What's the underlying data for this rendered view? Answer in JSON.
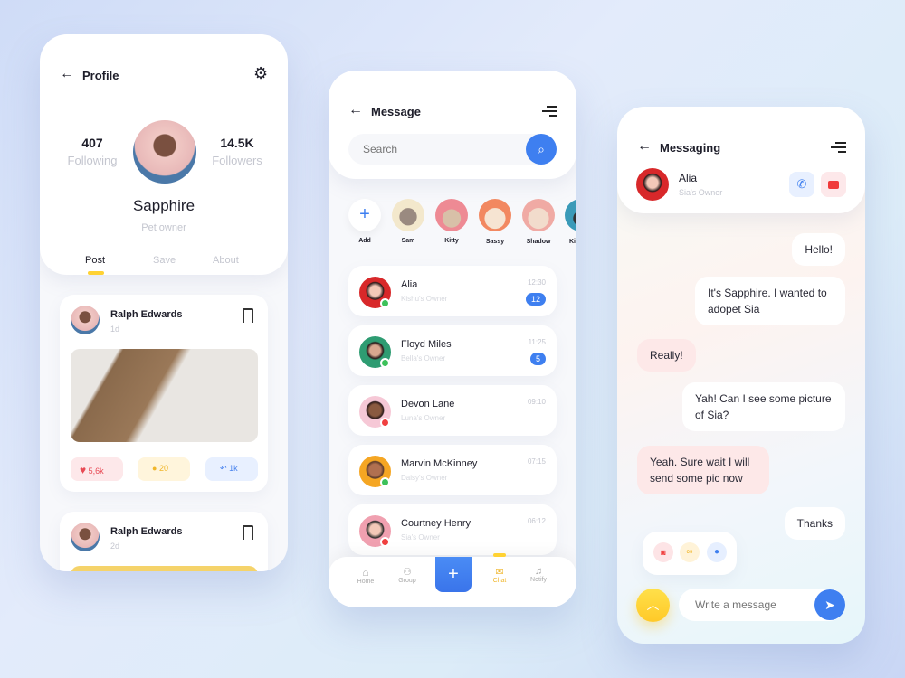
{
  "profile": {
    "title": "Profile",
    "following_count": "407",
    "following_label": "Following",
    "followers_count": "14.5K",
    "followers_label": "Followers",
    "name": "Sapphire",
    "role": "Pet owner",
    "tabs": [
      "Post",
      "Save",
      "About"
    ],
    "posts": [
      {
        "author": "Ralph Edwards",
        "time": "1d",
        "likes": "5,6k",
        "comments": "20",
        "shares": "1k"
      },
      {
        "author": "Ralph Edwards",
        "time": "2d"
      }
    ]
  },
  "message": {
    "title": "Message",
    "search_placeholder": "Search",
    "stories": [
      "Add",
      "Sam",
      "Kitty",
      "Sassy",
      "Shadow",
      "Ki"
    ],
    "chats": [
      {
        "name": "Alia",
        "sub": "Kishu's Owner",
        "time": "12:30",
        "unread": "12",
        "status": "online"
      },
      {
        "name": "Floyd Miles",
        "sub": "Bella's Owner",
        "time": "11:25",
        "unread": "5",
        "status": "online"
      },
      {
        "name": "Devon Lane",
        "sub": "Luna's Owner",
        "time": "09:10",
        "status": "offline"
      },
      {
        "name": "Marvin McKinney",
        "sub": "Daisy's Owner",
        "time": "07:15",
        "status": "online"
      },
      {
        "name": "Courtney Henry",
        "sub": "Sia's Owner",
        "time": "06:12",
        "status": "offline"
      }
    ],
    "nav": [
      "Home",
      "Group",
      "Chat",
      "Notify"
    ],
    "active_nav": "Chat"
  },
  "messaging": {
    "title": "Messaging",
    "contact_name": "Alia",
    "contact_sub": "Sia's Owner",
    "messages": [
      {
        "from": "me",
        "text": "Hello!"
      },
      {
        "from": "me",
        "text": "It's Sapphire. I wanted to adopet Sia"
      },
      {
        "from": "them",
        "text": "Really!"
      },
      {
        "from": "me",
        "text": "Yah! Can I see some picture of Sia?"
      },
      {
        "from": "them",
        "text": "Yeah. Sure wait I will send some pic now"
      },
      {
        "from": "me",
        "text": "Thanks"
      }
    ],
    "input_placeholder": "Write a message"
  },
  "colors": {
    "accent_blue": "#3e7ff0",
    "accent_yellow": "#ffd233",
    "online": "#3cc15a",
    "offline": "#f04040"
  }
}
